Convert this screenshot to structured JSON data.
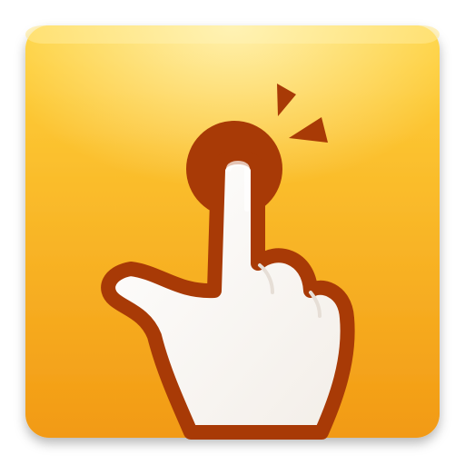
{
  "icon": {
    "name": "tap-gesture-app-icon",
    "colors": {
      "tile_top": "#FFD23A",
      "tile_bottom": "#F29A14",
      "tile_edge": "#F7B52A",
      "outline": "#A83A06",
      "hand_fill": "#FFFFFF",
      "glow": "#FFF6C2"
    }
  }
}
